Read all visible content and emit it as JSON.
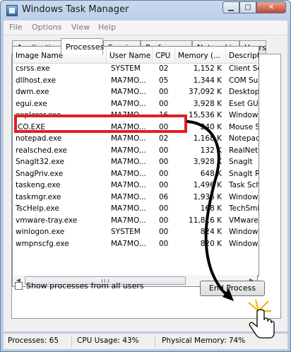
{
  "window": {
    "title": "Windows Task Manager",
    "caption_buttons": [
      "minimize-icon",
      "maximize-icon",
      "close-icon"
    ]
  },
  "menu": [
    "File",
    "Options",
    "View",
    "Help"
  ],
  "tabs": [
    "Applications",
    "Processes",
    "Services",
    "Performance",
    "Networking",
    "Users"
  ],
  "active_tab": "Processes",
  "columns": [
    "Image Name",
    "User Name",
    "CPU",
    "Memory (...",
    "Descripti"
  ],
  "processes": [
    {
      "name": "csrss.exe",
      "user": "SYSTEM",
      "cpu": "02",
      "mem": "1,152 K",
      "desc": "Client Se"
    },
    {
      "name": "dllhost.exe",
      "user": "MA7MO...",
      "cpu": "05",
      "mem": "1,344 K",
      "desc": "COM Sur"
    },
    {
      "name": "dwm.exe",
      "user": "MA7MO...",
      "cpu": "00",
      "mem": "37,092 K",
      "desc": "Desktop"
    },
    {
      "name": "egui.exe",
      "user": "MA7MO...",
      "cpu": "00",
      "mem": "3,928 K",
      "desc": "Eset GUI"
    },
    {
      "name": "explorer.exe",
      "user": "MA7MO...",
      "cpu": "16",
      "mem": "15,536 K",
      "desc": "Windows"
    },
    {
      "name": "ICO.EXE",
      "user": "MA7MO...",
      "cpu": "00",
      "mem": "240 K",
      "desc": "Mouse Se"
    },
    {
      "name": "notepad.exe",
      "user": "MA7MO...",
      "cpu": "02",
      "mem": "1,168 K",
      "desc": "Notepad"
    },
    {
      "name": "realsched.exe",
      "user": "MA7MO...",
      "cpu": "00",
      "mem": "132 K",
      "desc": "RealNetw"
    },
    {
      "name": "SnagIt32.exe",
      "user": "MA7MO...",
      "cpu": "00",
      "mem": "3,928 K",
      "desc": "SnagIt"
    },
    {
      "name": "SnagPriv.exe",
      "user": "MA7MO...",
      "cpu": "00",
      "mem": "648 K",
      "desc": "SnagIt R"
    },
    {
      "name": "taskeng.exe",
      "user": "MA7MO...",
      "cpu": "00",
      "mem": "1,496 K",
      "desc": "Task Sch"
    },
    {
      "name": "taskmgr.exe",
      "user": "MA7MO...",
      "cpu": "06",
      "mem": "1,936 K",
      "desc": "Windows"
    },
    {
      "name": "TscHelp.exe",
      "user": "MA7MO...",
      "cpu": "00",
      "mem": "168 K",
      "desc": "TechSmit"
    },
    {
      "name": "vmware-tray.exe",
      "user": "MA7MO...",
      "cpu": "00",
      "mem": "11,816 K",
      "desc": "VMware T"
    },
    {
      "name": "winlogon.exe",
      "user": "SYSTEM",
      "cpu": "00",
      "mem": "824 K",
      "desc": "Windows"
    },
    {
      "name": "wmpnscfg.exe",
      "user": "MA7MO...",
      "cpu": "00",
      "mem": "820 K",
      "desc": "Windows"
    }
  ],
  "show_all_label": "Show processes from all users",
  "end_process_label": "End Process",
  "status": {
    "processes": "Processes: 65",
    "cpu": "CPU Usage: 43%",
    "memory": "Physical Memory: 74%"
  },
  "colors": {
    "highlight": "#e02020",
    "arrow": "#000000",
    "burst": "#f2b400"
  }
}
